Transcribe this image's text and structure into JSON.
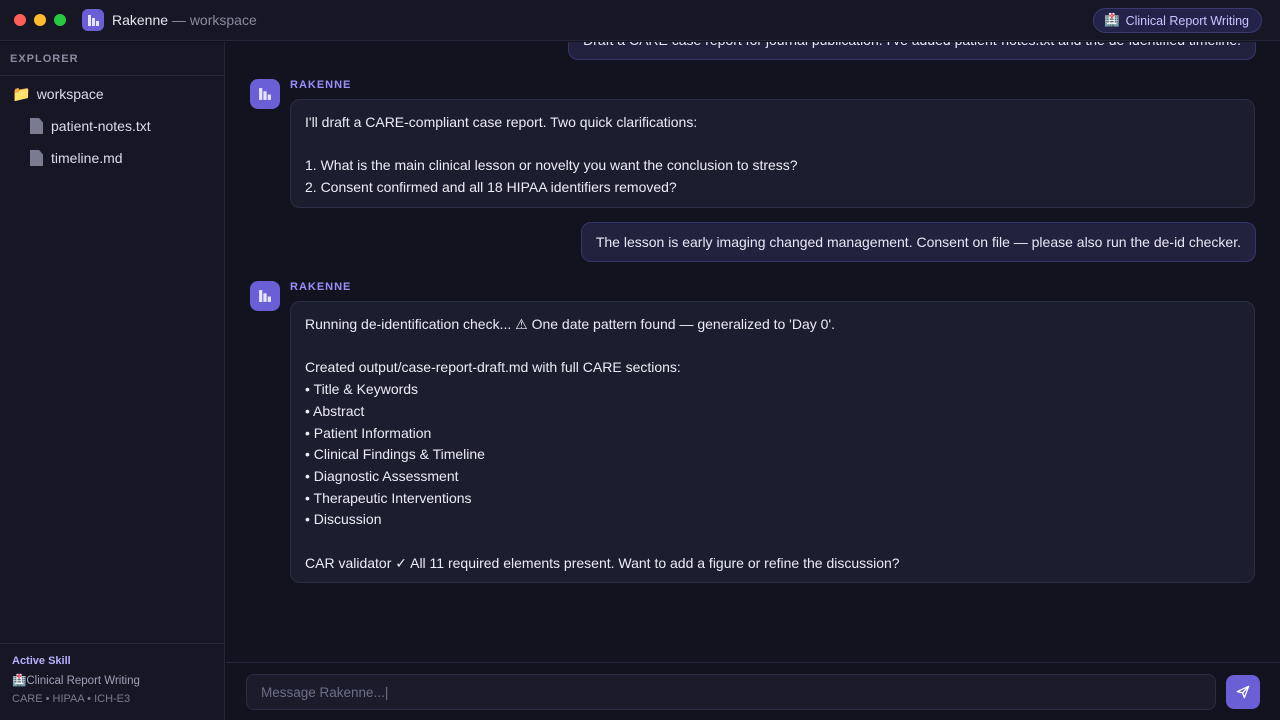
{
  "window": {
    "app_name": "Rakenne",
    "title_suffix": " — workspace",
    "skill_pill": {
      "icon": "hospital-emoji",
      "emoji": "🏥",
      "label": "Clinical Report Writing"
    }
  },
  "sidebar": {
    "header": "EXPLORER",
    "folder": {
      "emoji": "📁",
      "label": "workspace"
    },
    "files": [
      {
        "label": "patient-notes.txt"
      },
      {
        "label": "timeline.md"
      }
    ],
    "active_skill": {
      "title": "Active Skill",
      "emoji": "🏥",
      "name": "Clinical Report Writing",
      "tags": "CARE • HIPAA • ICH-E3"
    }
  },
  "chat": {
    "sender_name": "RAKENNE",
    "messages": [
      {
        "role": "user",
        "text": "Draft a CARE case report for journal publication. I've added patient-notes.txt and the de-identified timeline."
      },
      {
        "role": "assistant",
        "text": "I'll draft a CARE-compliant case report. Two quick clarifications:\n\n1. What is the main clinical lesson or novelty you want the conclusion to stress?\n2. Consent confirmed and all 18 HIPAA identifiers removed?"
      },
      {
        "role": "user",
        "text": "The lesson is early imaging changed management. Consent on file — please also run the de-id checker."
      },
      {
        "role": "assistant",
        "text": "Running de-identification check... ⚠ One date pattern found — generalized to 'Day 0'.\n\nCreated output/case-report-draft.md with full CARE sections:\n• Title & Keywords\n• Abstract\n• Patient Information\n• Clinical Findings & Timeline\n• Diagnostic Assessment\n• Therapeutic Interventions\n• Discussion\n\nCAR validator ✓ All 11 required elements present. Want to add a figure or refine the discussion?"
      }
    ]
  },
  "composer": {
    "placeholder": "Message Rakenne...|"
  },
  "colors": {
    "accent": "#6b5fd6",
    "background": "#13131f",
    "panel": "#161624",
    "bubble": "#1d1d30",
    "user_bubble": "#22223e"
  }
}
